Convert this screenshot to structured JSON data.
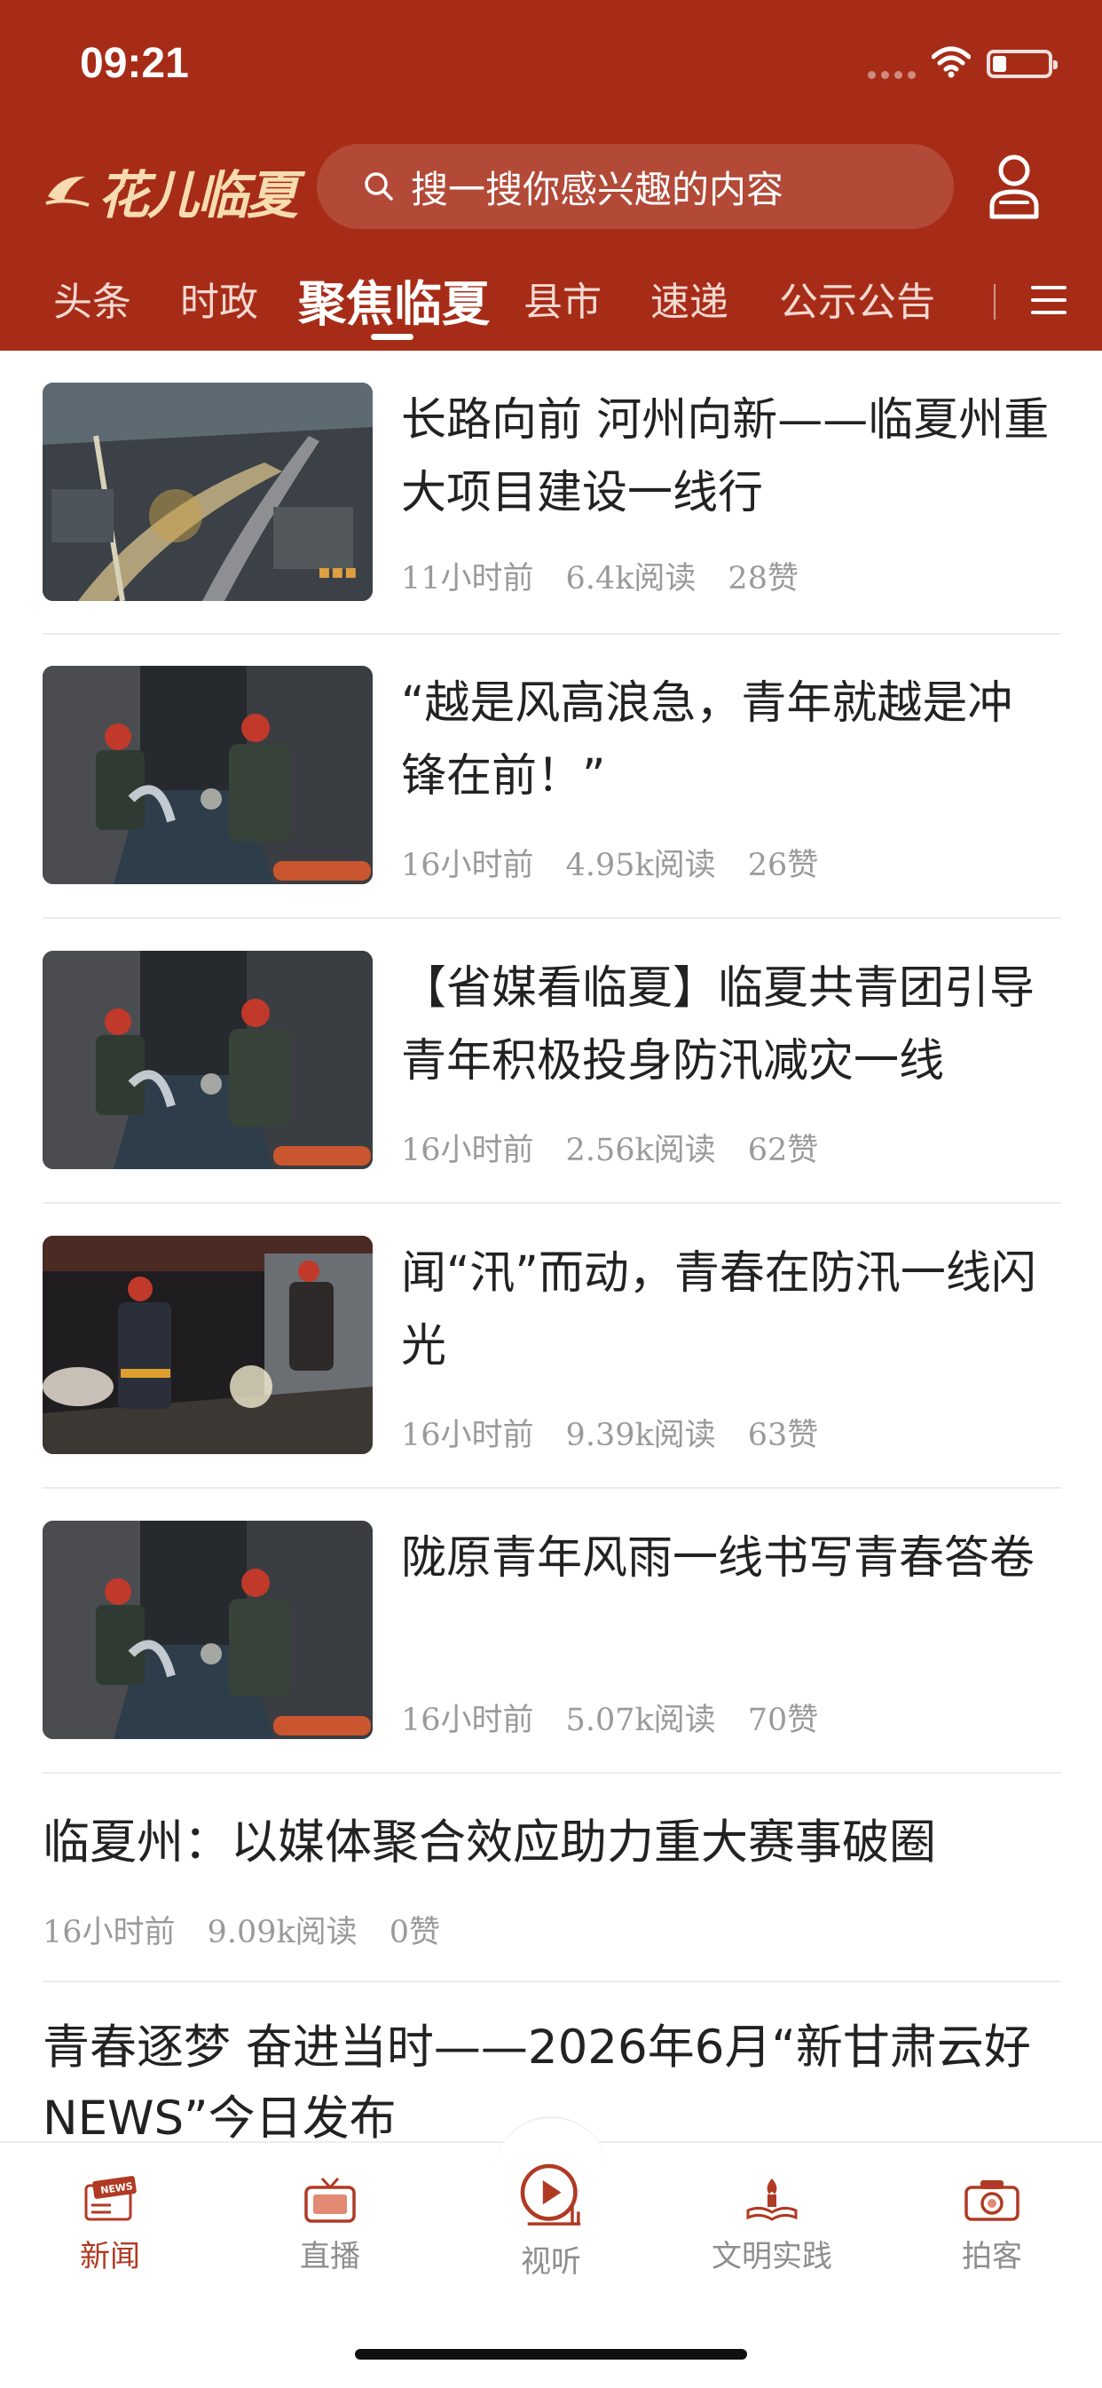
{
  "status_bar": {
    "time": "09:21",
    "battery_level": 0.25
  },
  "header": {
    "logo_text": "花儿临夏",
    "search_placeholder": "搜一搜你感兴趣的内容"
  },
  "nav": {
    "tabs": [
      {
        "label": "头条",
        "active": false
      },
      {
        "label": "时政",
        "active": false
      },
      {
        "label": "聚焦临夏",
        "active": true
      },
      {
        "label": "县市",
        "active": false
      },
      {
        "label": "速递",
        "active": false
      },
      {
        "label": "公示公告",
        "active": false
      }
    ]
  },
  "feed": {
    "items": [
      {
        "title": "长路向前  河州向新——临夏州重大项目建设一线行",
        "time": "11小时前",
        "reads": "6.4k阅读",
        "likes": "28赞",
        "thumb": "aerial-highway-night"
      },
      {
        "title": "“越是风高浪急，青年就越是冲锋在前！”",
        "time": "16小时前",
        "reads": "4.95k阅读",
        "likes": "26赞",
        "thumb": "firefighters-flood-pumping"
      },
      {
        "title": "【省媒看临夏】临夏共青团引导青年积极投身防汛减灾一线",
        "time": "16小时前",
        "reads": "2.56k阅读",
        "likes": "62赞",
        "thumb": "firefighters-flood-pumping"
      },
      {
        "title": "闻“汛”而动，青春在防汛一线闪光",
        "time": "16小时前",
        "reads": "9.39k阅读",
        "likes": "63赞",
        "thumb": "firefighters-night-street"
      },
      {
        "title": "陇原青年风雨一线书写青春答卷",
        "time": "16小时前",
        "reads": "5.07k阅读",
        "likes": "70赞",
        "thumb": "firefighters-flood-pumping"
      }
    ],
    "text_items": [
      {
        "title": "临夏州：以媒体聚合效应助力重大赛事破圈",
        "time": "16小时前",
        "reads": "9.09k阅读",
        "likes": "0赞"
      },
      {
        "title": "青春逐梦  奋进当时——2026年6月“新甘肃云好NEWS”今日发布"
      }
    ]
  },
  "tabbar": {
    "items": [
      {
        "label": "新闻",
        "icon": "news-icon",
        "active": true
      },
      {
        "label": "直播",
        "icon": "tv-icon",
        "active": false
      },
      {
        "label": "视听",
        "icon": "play-icon",
        "active": false
      },
      {
        "label": "文明实践",
        "icon": "torch-icon",
        "active": false
      },
      {
        "label": "拍客",
        "icon": "camera-icon",
        "active": false
      }
    ]
  },
  "colors": {
    "brand_red": "#a72c17",
    "active_tab": "#b03a23",
    "meta_gray": "#9a9a9a"
  }
}
